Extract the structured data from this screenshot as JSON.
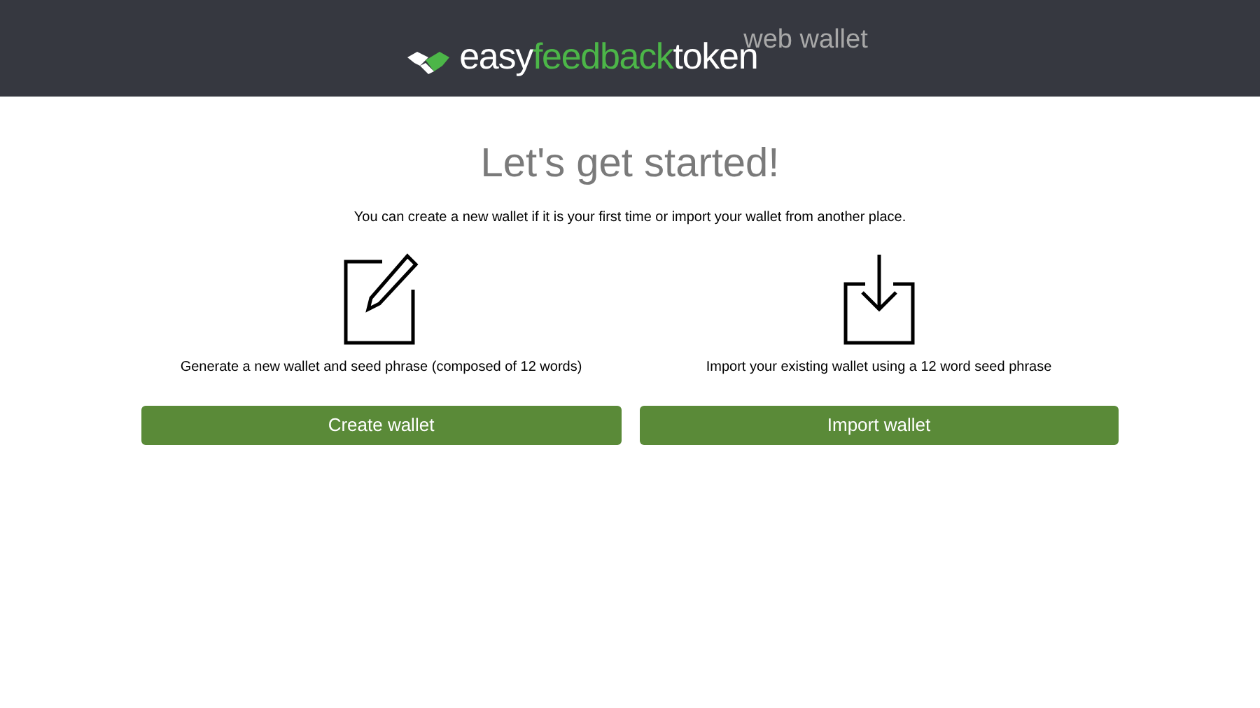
{
  "header": {
    "logo_parts": [
      {
        "text": "easy",
        "color": "#ffffff"
      },
      {
        "text": "feedback",
        "color": "#4cb648"
      },
      {
        "text": "token",
        "color": "#ffffff"
      }
    ],
    "tagline": "web wallet"
  },
  "title": "Let's get started!",
  "intro": "You can create a new wallet if it is your first time or import your wallet from another place.",
  "options": [
    {
      "kind": "create",
      "description": "Generate a new wallet and seed phrase (composed of 12 words)",
      "button": "Create wallet"
    },
    {
      "kind": "import",
      "description": "Import your existing wallet using a 12 word seed phrase",
      "button": "Import wallet"
    }
  ]
}
